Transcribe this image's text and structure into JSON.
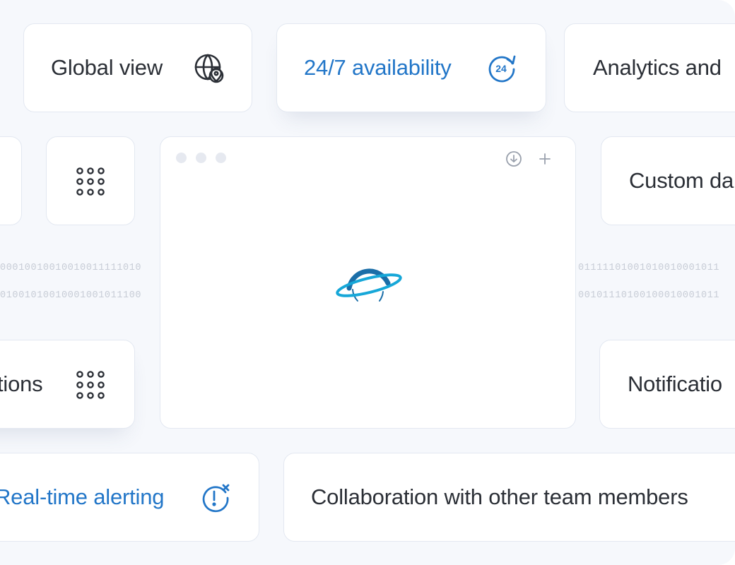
{
  "features": {
    "global_view": "Global view",
    "availability": "24/7 availability",
    "analytics": "Analytics and",
    "custom": "Custom da",
    "integrations": "tions",
    "notifications": "Notificatio",
    "alerting": "Real-time alerting",
    "collaboration": "Collaboration with other team members"
  },
  "binary": {
    "left_1": "00010010010010011111010",
    "left_2": "01001010010001001011100",
    "right_1": "01111101001010010001011",
    "right_2": "00101110100100010001011"
  },
  "icons": {
    "globe": "globe-pin-icon",
    "clock24": "clock-24-icon",
    "dots_grid_a": "dots-grid-icon",
    "dots_grid_b": "dots-grid-icon",
    "alert": "alert-clock-icon",
    "download": "download-icon",
    "plus": "plus-icon",
    "logo": "orbit-logo"
  },
  "colors": {
    "accent": "#2276c8",
    "text": "#2b2f36",
    "logo_dark": "#1a6ea8",
    "logo_light": "#16a7d8"
  }
}
